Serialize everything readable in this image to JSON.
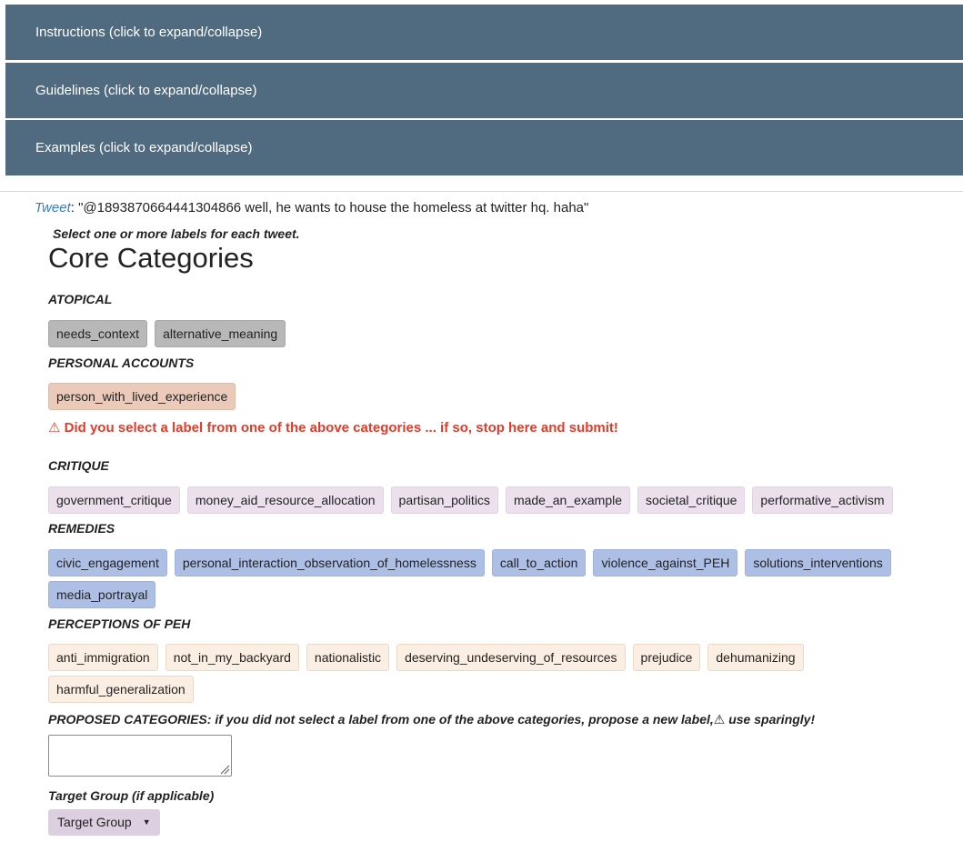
{
  "panels": [
    {
      "label": "Instructions (click to expand/collapse)"
    },
    {
      "label": "Guidelines (click to expand/collapse)"
    },
    {
      "label": "Examples (click to expand/collapse)"
    }
  ],
  "tweet": {
    "label": "Tweet",
    "text": ": \"@1893870664441304866 well, he wants to house the homeless at twitter hq. haha\""
  },
  "instruction": "Select one or more labels for each tweet.",
  "heading": "Core Categories",
  "categories": {
    "atopical": {
      "title": "ATOPICAL",
      "labels": [
        "needs_context",
        "alternative_meaning"
      ]
    },
    "personal": {
      "title": "PERSONAL ACCOUNTS",
      "labels": [
        "person_with_lived_experience"
      ]
    },
    "critique": {
      "title": "CRITIQUE",
      "labels": [
        "government_critique",
        "money_aid_resource_allocation",
        "partisan_politics",
        "made_an_example",
        "societal_critique",
        "performative_activism"
      ]
    },
    "remedies": {
      "title": "REMEDIES",
      "labels": [
        "civic_engagement",
        "personal_interaction_observation_of_homelessness",
        "call_to_action",
        "violence_against_PEH",
        "solutions_interventions",
        "media_portrayal"
      ]
    },
    "perceptions": {
      "title": "PERCEPTIONS OF PEH",
      "labels": [
        "anti_immigration",
        "not_in_my_backyard",
        "nationalistic",
        "deserving_undeserving_of_resources",
        "prejudice",
        "dehumanizing",
        "harmful_generalization"
      ]
    }
  },
  "warning": "⚠ Did you select a label from one of the above categories ... if so, stop here and submit!",
  "proposed": {
    "title": "PROPOSED CATEGORIES: if you did not select a label from one of the above categories, propose a new label,⚠ use sparingly!",
    "value": ""
  },
  "target": {
    "title": "Target Group (if applicable)",
    "selected": "Target Group",
    "caret_icon": "caret-down-icon"
  },
  "colors": {
    "panel": "#506a7f",
    "warning": "#e23b2a",
    "link": "#3a7bc4",
    "atopical": "#b8b8b8",
    "personal": "#ebcab9",
    "critique": "#ebe0ec",
    "remedies": "#aebfe6",
    "perceptions": "#fbefe3",
    "dropdown": "#dccfe0"
  }
}
